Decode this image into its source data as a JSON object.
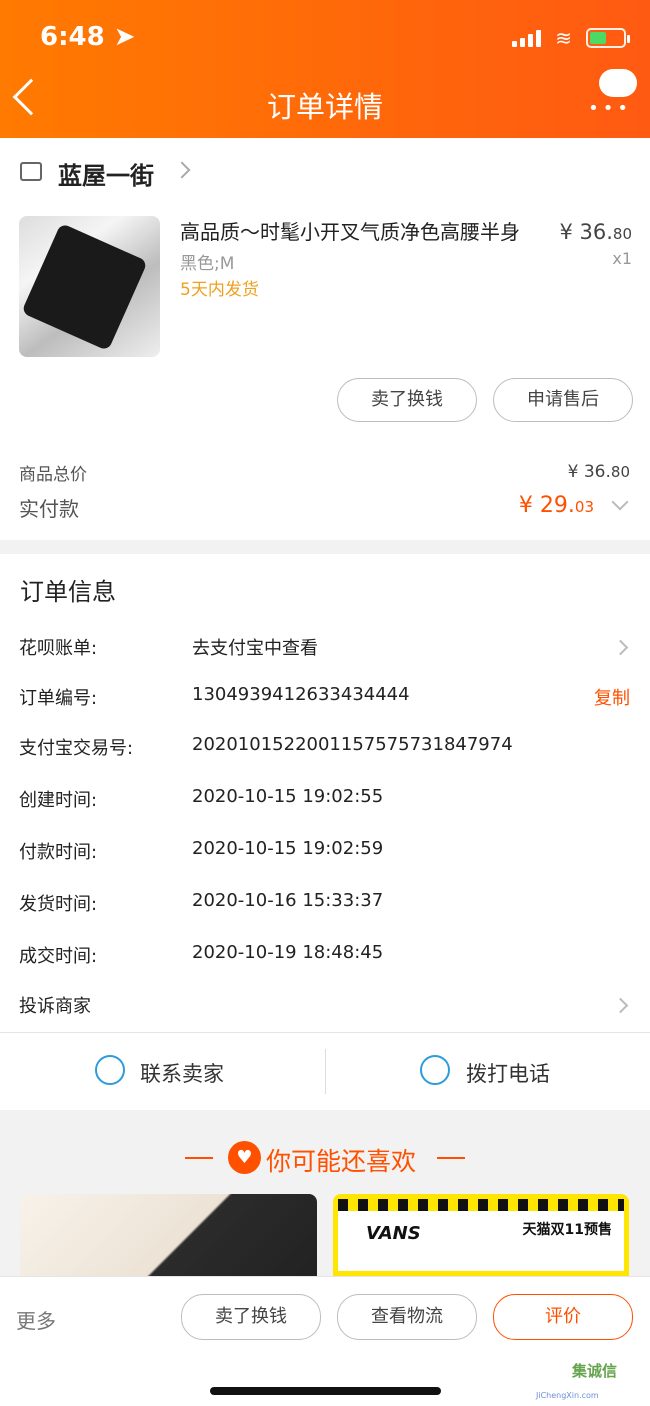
{
  "status": {
    "time": "6:48"
  },
  "header": {
    "title": "订单详情"
  },
  "shop": {
    "name": "蓝屋一街"
  },
  "product": {
    "title": "高品质～时髦小开叉气质净色高腰半身",
    "price_main": "¥ 36.",
    "price_cents": "80",
    "spec": "黑色;M",
    "quantity": "x1",
    "delivery": "5天内发货"
  },
  "item_actions": {
    "sell": "卖了换钱",
    "after_sales": "申请售后"
  },
  "summary": {
    "total_label": "商品总价",
    "total_main": "¥ 36.",
    "total_cents": "80",
    "paid_label": "实付款",
    "paid_main": "¥ 29.",
    "paid_cents": "03"
  },
  "order_info": {
    "title": "订单信息",
    "rows": [
      {
        "label": "花呗账单:",
        "value": "去支付宝中查看"
      },
      {
        "label": "订单编号:",
        "value": "1304939412633434444",
        "action": "复制"
      },
      {
        "label": "支付宝交易号:",
        "value": "2020101522001157575731847974"
      },
      {
        "label": "创建时间:",
        "value": "2020-10-15 19:02:55"
      },
      {
        "label": "付款时间:",
        "value": "2020-10-15 19:02:59"
      },
      {
        "label": "发货时间:",
        "value": "2020-10-16 15:33:37"
      },
      {
        "label": "成交时间:",
        "value": "2020-10-19 18:48:45"
      },
      {
        "label": "投诉商家",
        "value": ""
      }
    ]
  },
  "contact": {
    "seller": "联系卖家",
    "phone": "拨打电话"
  },
  "recommend": {
    "title": "你可能还喜欢",
    "brand": "VANS",
    "presale": "天猫双11预售"
  },
  "bottom_bar": {
    "more": "更多",
    "sell": "卖了换钱",
    "logistics": "查看物流",
    "review": "评价"
  },
  "watermark": {
    "text": "集诚信",
    "sub": "JiChengXin.com"
  },
  "colors": {
    "accent": "#ff5000",
    "header_start": "#ff7a00",
    "header_end": "#ff5a12",
    "contact": "#2d9cdb"
  },
  "icons": [
    "location-arrow-icon",
    "signal-icon",
    "wifi-icon",
    "battery-icon",
    "back-icon",
    "chat-icon",
    "store-icon",
    "chevron-right-icon",
    "chevron-down-icon",
    "message-icon",
    "phone-icon",
    "heart-icon"
  ]
}
